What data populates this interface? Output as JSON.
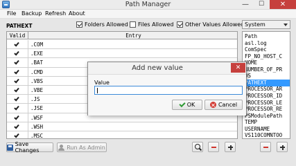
{
  "window": {
    "title": "Path Manager",
    "minimize": "—",
    "maximize": "☐",
    "close": "✕"
  },
  "menu": [
    "File",
    "Backup",
    "Refresh",
    "About"
  ],
  "variable_name": "PATHEXT",
  "options": {
    "folders_allowed": {
      "label": "Folders Allowed",
      "checked": true
    },
    "files_allowed": {
      "label": "Files Allowed",
      "checked": false
    },
    "other_values_allowed": {
      "label": "Other Values Allowed",
      "checked": true
    }
  },
  "scope_dropdown": {
    "selected": "System"
  },
  "table": {
    "columns": [
      "Valid",
      "Entry"
    ],
    "rows": [
      {
        "valid": true,
        "entry": ".COM"
      },
      {
        "valid": true,
        "entry": ".EXE"
      },
      {
        "valid": true,
        "entry": ".BAT"
      },
      {
        "valid": true,
        "entry": ".CMD"
      },
      {
        "valid": true,
        "entry": ".VBS"
      },
      {
        "valid": true,
        "entry": ".VBE"
      },
      {
        "valid": true,
        "entry": ".JS"
      },
      {
        "valid": true,
        "entry": ".JSE"
      },
      {
        "valid": true,
        "entry": ".WSF"
      },
      {
        "valid": true,
        "entry": ".WSH"
      },
      {
        "valid": true,
        "entry": ".MSC"
      }
    ]
  },
  "variables": {
    "items": [
      "Path",
      "asl.log",
      "ComSpec",
      "FP_NO_HOST_C",
      "HOME",
      "NUMBER_OF_PR",
      "OS",
      "PATHEXT",
      "PROCESSOR_AR",
      "PROCESSOR_ID",
      "PROCESSOR_LE",
      "PROCESSOR_RE",
      "PSModulePath",
      "TEMP",
      "USERNAME",
      "VS110COMNTOO"
    ],
    "selected": "PATHEXT"
  },
  "toolbar": {
    "save_label": "Save Changes",
    "run_admin_label": "Run As Admin"
  },
  "dialog": {
    "title": "Add new value",
    "close": "✕",
    "value_label": "Value",
    "value": "",
    "ok_label": "OK",
    "cancel_label": "Cancel"
  },
  "colors": {
    "selection": "#3399ff",
    "close_red": "#c6403d",
    "minus_red": "#d0342c"
  }
}
